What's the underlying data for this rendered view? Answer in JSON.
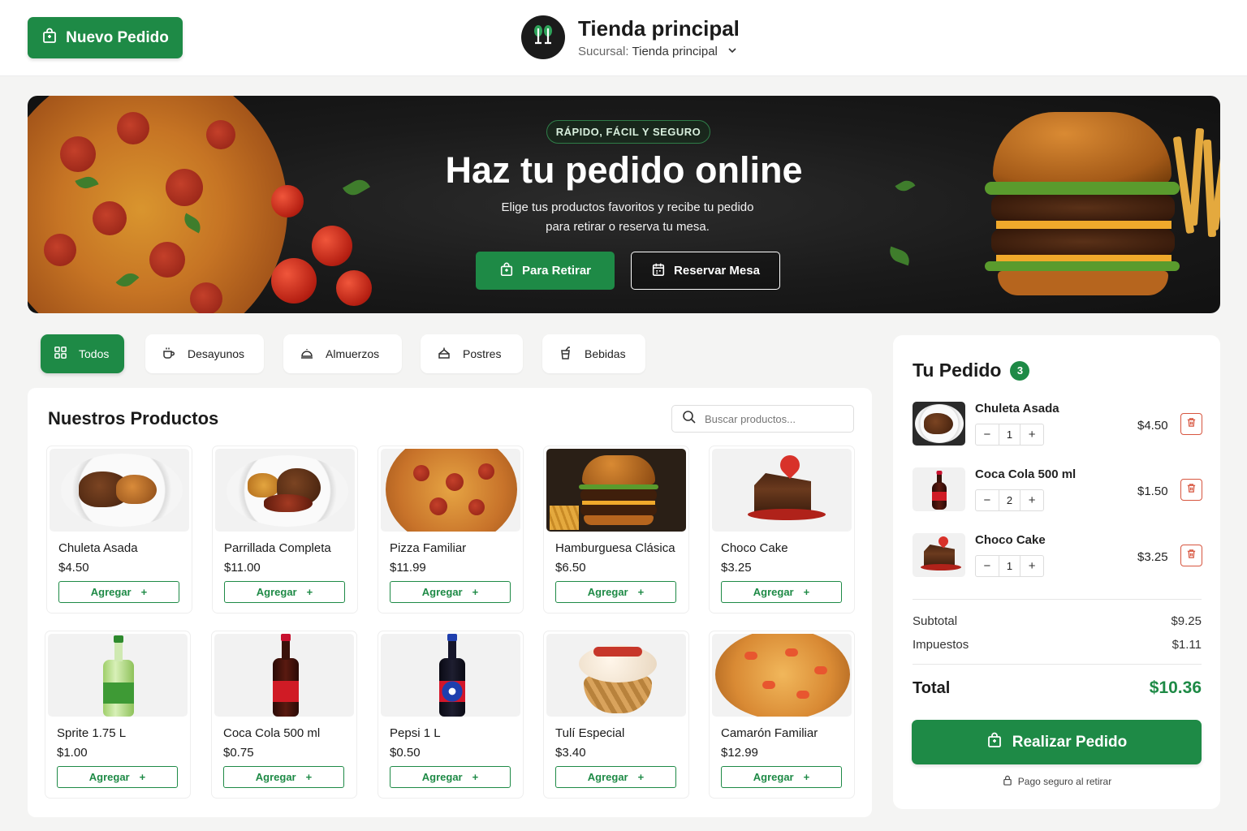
{
  "header": {
    "new_order_label": "Nuevo Pedido",
    "store_title": "Tienda principal",
    "branch_label": "Sucursal:",
    "branch_value": "Tienda principal"
  },
  "hero": {
    "badge": "RÁPIDO, FÁCIL Y SEGURO",
    "title": "Haz tu pedido online",
    "desc_line1": "Elige tus productos favoritos y recibe tu pedido",
    "desc_line2": "para retirar o reserva tu mesa.",
    "pickup_label": "Para Retirar",
    "reserve_label": "Reservar Mesa"
  },
  "categories": [
    {
      "label": "Todos",
      "icon": "grid-icon",
      "active": true
    },
    {
      "label": "Desayunos",
      "icon": "coffee-cup-icon",
      "active": false
    },
    {
      "label": "Almuerzos",
      "icon": "cloche-icon",
      "active": false
    },
    {
      "label": "Postres",
      "icon": "cake-icon",
      "active": false
    },
    {
      "label": "Bebidas",
      "icon": "drink-icon",
      "active": false
    }
  ],
  "products": {
    "title": "Nuestros Productos",
    "search_placeholder": "Buscar productos...",
    "add_label": "Agregar",
    "items": [
      {
        "name": "Chuleta Asada",
        "price": "$4.50"
      },
      {
        "name": "Parrillada Completa",
        "price": "$11.00"
      },
      {
        "name": "Pizza Familiar",
        "price": "$11.99"
      },
      {
        "name": "Hamburguesa Clásica",
        "price": "$6.50"
      },
      {
        "name": "Choco Cake",
        "price": "$3.25"
      },
      {
        "name": "Sprite 1.75 L",
        "price": "$1.00"
      },
      {
        "name": "Coca Cola 500 ml",
        "price": "$0.75"
      },
      {
        "name": "Pepsi 1 L",
        "price": "$0.50"
      },
      {
        "name": "Tulí Especial",
        "price": "$3.40"
      },
      {
        "name": "Camarón Familiar",
        "price": "$12.99"
      }
    ]
  },
  "order": {
    "title": "Tu Pedido",
    "count": "3",
    "items": [
      {
        "name": "Chuleta Asada",
        "qty": "1",
        "price": "$4.50"
      },
      {
        "name": "Coca Cola 500 ml",
        "qty": "2",
        "price": "$1.50"
      },
      {
        "name": "Choco Cake",
        "qty": "1",
        "price": "$3.25"
      }
    ],
    "subtotal_label": "Subtotal",
    "subtotal_value": "$9.25",
    "tax_label": "Impuestos",
    "tax_value": "$1.11",
    "total_label": "Total",
    "total_value": "$10.36",
    "submit_label": "Realizar Pedido",
    "secure_note": "Pago seguro al retirar"
  },
  "colors": {
    "brand_green": "#1e8a46",
    "delete_red": "#d7553f"
  }
}
